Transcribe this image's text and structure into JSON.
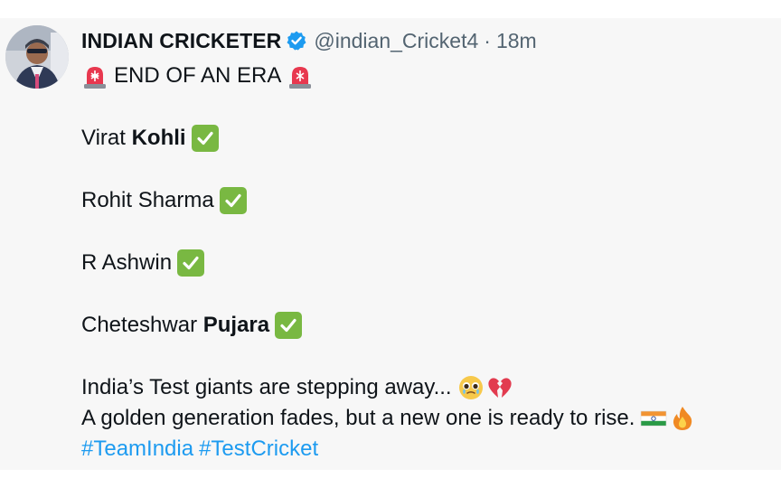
{
  "tweet": {
    "author_name": "INDIAN CRICKETER",
    "handle": "@indian_Cricket4",
    "separator": "·",
    "time": "18m",
    "lines": {
      "headline": "END OF AN ERA",
      "p1a": "Virat ",
      "p1b": "Kohli",
      "p2": "Rohit Sharma",
      "p3": "R Ashwin",
      "p4a": "Cheteshwar ",
      "p4b": "Pujara",
      "p5": "India’s Test giants are stepping away...",
      "p6": "A golden generation fades, but a new one is ready to rise."
    },
    "hashtags": [
      "#TeamIndia",
      "#TestCricket"
    ],
    "colors": {
      "verified": "#1d9bf0",
      "hashtag": "#1d9bf0",
      "check": "#79b842",
      "siren": "#e8384f"
    },
    "icons": {
      "verified": "verified-badge-icon",
      "headline": "police-car-light-emoji",
      "check": "check-mark-button-emoji",
      "tears": "pleading-face-emoji",
      "heart": "broken-heart-emoji",
      "flag": "india-flag-emoji",
      "fire": "fire-emoji"
    }
  }
}
